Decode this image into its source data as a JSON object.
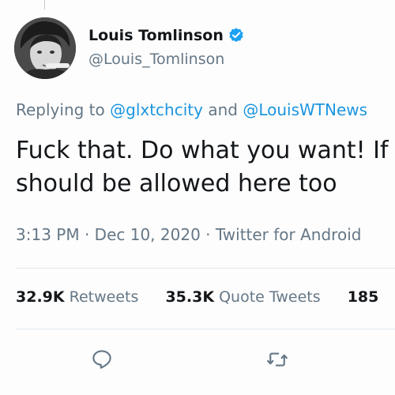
{
  "user": {
    "name": "Louis Tomlinson",
    "handle": "@Louis_Tomlinson"
  },
  "reply": {
    "prefix": "Replying to ",
    "mention1": "@glxtchcity",
    "conjunction": " and ",
    "mention2": "@LouisWTNews"
  },
  "tweet": {
    "line1": "Fuck that. Do what you want! If",
    "line2": "should be allowed here too"
  },
  "meta": {
    "time": "3:13 PM",
    "sep1": " · ",
    "date": "Dec 10, 2020",
    "sep2": " · ",
    "client": "Twitter for Android"
  },
  "stats": [
    {
      "value": "32.9K",
      "label": " Retweets"
    },
    {
      "value": "35.3K",
      "label": " Quote Tweets"
    },
    {
      "value": "185",
      "label": ""
    }
  ],
  "icons": {
    "verified": "verified-badge-icon",
    "reply": "reply-icon",
    "retweet": "retweet-icon"
  },
  "colors": {
    "link": "#1b95e0",
    "muted": "#657786",
    "text": "#14171a",
    "verified": "#1da1f2"
  }
}
